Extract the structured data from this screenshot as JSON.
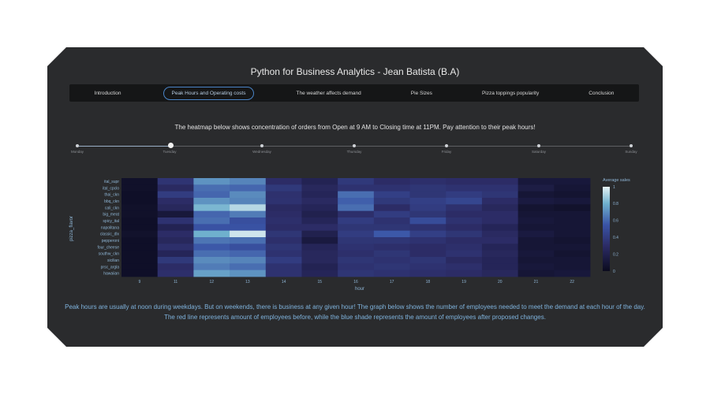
{
  "app": {
    "title": "Python for Business Analytics - Jean Batista (B.A)"
  },
  "tabs": [
    {
      "label": "Introduction",
      "active": false
    },
    {
      "label": "Peak Hours and Operating costs",
      "active": true
    },
    {
      "label": "The weather affects demand",
      "active": false
    },
    {
      "label": "Pie Sizes",
      "active": false
    },
    {
      "label": "Pizza toppings popularity",
      "active": false
    },
    {
      "label": "Conclusion",
      "active": false
    }
  ],
  "intro_text": "The heatmap below shows concentration of orders from Open at 9 AM to Closing time at 11PM. Pay attention to their peak hours!",
  "day_slider": {
    "days": [
      "Monday",
      "Tuesday",
      "Wednesday",
      "Thursday",
      "Friday",
      "Saturday",
      "Sunday"
    ],
    "selected": "Tuesday"
  },
  "chart_data": {
    "type": "heatmap",
    "title": "",
    "xlabel": "hour",
    "ylabel": "pizza_flavor",
    "x": [
      "9",
      "11",
      "12",
      "13",
      "14",
      "15",
      "16",
      "17",
      "18",
      "19",
      "20",
      "21",
      "22"
    ],
    "y": [
      "ital_supr",
      "ital_cpclo",
      "thai_ckn",
      "bbq_ckn",
      "cali_ckn",
      "big_meat",
      "spicy_ital",
      "napolitana",
      "classic_dlx",
      "pepperoni",
      "four_cheese",
      "southw_ckn",
      "sicilian",
      "prsc_argla",
      "hawaiian"
    ],
    "colorbar": {
      "title": "Average sales",
      "ticks": [
        0,
        0.2,
        0.4,
        0.6,
        0.8,
        1
      ],
      "range": [
        0,
        1
      ]
    },
    "z": [
      [
        0.05,
        0.35,
        0.72,
        0.68,
        0.3,
        0.22,
        0.38,
        0.3,
        0.32,
        0.3,
        0.3,
        0.12,
        0.12
      ],
      [
        0.05,
        0.28,
        0.62,
        0.6,
        0.38,
        0.26,
        0.34,
        0.34,
        0.36,
        0.34,
        0.34,
        0.16,
        0.1
      ],
      [
        0.04,
        0.4,
        0.6,
        0.7,
        0.33,
        0.24,
        0.62,
        0.42,
        0.36,
        0.4,
        0.36,
        0.1,
        0.08
      ],
      [
        0.04,
        0.3,
        0.72,
        0.68,
        0.34,
        0.28,
        0.58,
        0.38,
        0.42,
        0.46,
        0.3,
        0.14,
        0.12
      ],
      [
        0.05,
        0.26,
        0.82,
        0.92,
        0.28,
        0.24,
        0.62,
        0.3,
        0.4,
        0.33,
        0.26,
        0.08,
        0.06
      ],
      [
        0.05,
        0.12,
        0.6,
        0.66,
        0.3,
        0.2,
        0.32,
        0.4,
        0.36,
        0.3,
        0.3,
        0.1,
        0.1
      ],
      [
        0.04,
        0.34,
        0.62,
        0.52,
        0.32,
        0.24,
        0.4,
        0.34,
        0.5,
        0.34,
        0.3,
        0.12,
        0.1
      ],
      [
        0.04,
        0.22,
        0.54,
        0.54,
        0.3,
        0.3,
        0.36,
        0.36,
        0.34,
        0.3,
        0.24,
        0.1,
        0.1
      ],
      [
        0.06,
        0.3,
        0.8,
        0.96,
        0.36,
        0.2,
        0.4,
        0.56,
        0.42,
        0.36,
        0.28,
        0.14,
        0.1
      ],
      [
        0.04,
        0.26,
        0.64,
        0.62,
        0.32,
        0.14,
        0.36,
        0.36,
        0.34,
        0.3,
        0.3,
        0.1,
        0.08
      ],
      [
        0.04,
        0.32,
        0.56,
        0.52,
        0.36,
        0.24,
        0.34,
        0.32,
        0.3,
        0.32,
        0.24,
        0.1,
        0.1
      ],
      [
        0.04,
        0.24,
        0.62,
        0.6,
        0.34,
        0.26,
        0.32,
        0.36,
        0.3,
        0.34,
        0.26,
        0.12,
        0.08
      ],
      [
        0.04,
        0.38,
        0.7,
        0.68,
        0.4,
        0.26,
        0.36,
        0.34,
        0.36,
        0.28,
        0.24,
        0.1,
        0.1
      ],
      [
        0.04,
        0.3,
        0.66,
        0.62,
        0.34,
        0.22,
        0.34,
        0.36,
        0.34,
        0.32,
        0.24,
        0.12,
        0.1
      ],
      [
        0.04,
        0.32,
        0.76,
        0.72,
        0.34,
        0.24,
        0.36,
        0.34,
        0.32,
        0.3,
        0.26,
        0.1,
        0.12
      ]
    ]
  },
  "footer_text": "Peak hours are usually at noon during weekdays. But on weekends, there is business at any given hour! The graph below shows the number of employees needed to meet the demand at each hour of the day. The red line represents amount of employees before, while the blue shade represents the amount of employees after proposed changes.",
  "colors": {
    "background": "#2a2b2d",
    "tab_bar": "#151617",
    "active_tab_border": "#4a84c7",
    "footer_text": "#7fb3dd",
    "axis_text": "#8fb6d6"
  }
}
